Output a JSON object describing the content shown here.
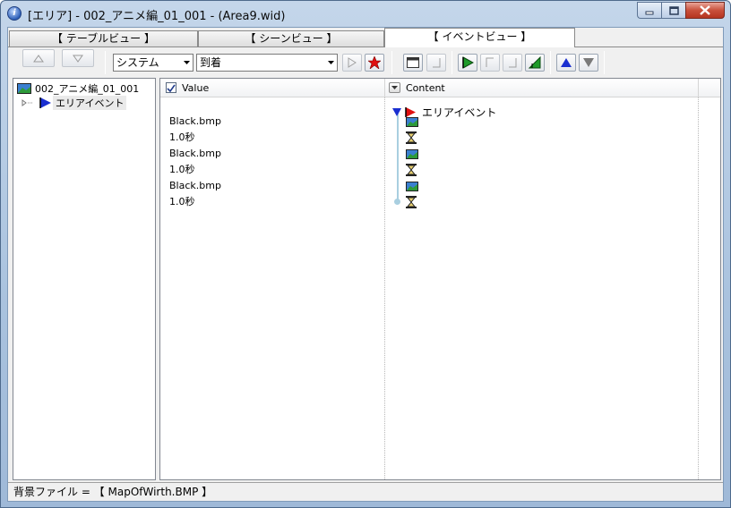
{
  "window": {
    "title": "[エリア] - 002_アニメ編_01_001 - (Area9.wid)"
  },
  "tabs": [
    {
      "label": "【 テーブルビュー 】"
    },
    {
      "label": "【 シーンビュー 】"
    },
    {
      "label": "【 イベントビュー 】",
      "active": true
    }
  ],
  "toolbar": {
    "category_value": "システム",
    "event_value": "到着"
  },
  "tree": {
    "root_label": "002_アニメ編_01_001",
    "child_label": "エリアイベント"
  },
  "grid": {
    "columns": [
      {
        "label": "Value",
        "checked": true
      },
      {
        "label": "Content"
      }
    ],
    "rows": [
      {
        "value": "",
        "content": "エリアイベント",
        "icon": "red-flag-icon"
      },
      {
        "value": "Black.bmp",
        "content": "",
        "icon": "image-icon"
      },
      {
        "value": "1.0秒",
        "content": "",
        "icon": "hourglass-icon"
      },
      {
        "value": "Black.bmp",
        "content": "",
        "icon": "image-icon"
      },
      {
        "value": "1.0秒",
        "content": "",
        "icon": "hourglass-icon"
      },
      {
        "value": "Black.bmp",
        "content": "",
        "icon": "image-icon"
      },
      {
        "value": "1.0秒",
        "content": "",
        "icon": "hourglass-icon"
      }
    ]
  },
  "status": {
    "text": "背景ファイル = 【 MapOfWirth.BMP 】"
  },
  "colors": {
    "accent_blue": "#1a2fd0",
    "flag_red": "#e01010",
    "timeline": "#a9cfe0"
  }
}
